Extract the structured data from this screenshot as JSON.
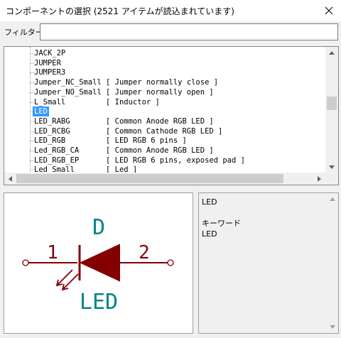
{
  "window": {
    "title": "コンポーネントの選択 (2521 アイテムが読込まれています)"
  },
  "filter": {
    "label": "フィルター:",
    "value": ""
  },
  "tree": {
    "rows": [
      {
        "name": "JACK_2P",
        "desc": ""
      },
      {
        "name": "JUMPER",
        "desc": ""
      },
      {
        "name": "JUMPER3",
        "desc": ""
      },
      {
        "name": "Jumper_NC_Small",
        "desc": "[ Jumper normally close ]"
      },
      {
        "name": "Jumper_NO_Small",
        "desc": "[ Jumper normally open ]"
      },
      {
        "name": "L_Small",
        "desc": "[ Inductor ]"
      },
      {
        "name": "LED",
        "desc": ""
      },
      {
        "name": "LED_RABG",
        "desc": "[ Common Anode RGB LED ]"
      },
      {
        "name": "LED_RCBG",
        "desc": "[ Common Cathode RGB LED ]"
      },
      {
        "name": "LED_RGB",
        "desc": "[ LED RGB 6 pins ]"
      },
      {
        "name": "Led_RGB_CA",
        "desc": "[ Common Anode RGB LED ]"
      },
      {
        "name": "LED_RGB_EP",
        "desc": "[ LED RGB 6 pins, exposed pad ]"
      },
      {
        "name": "Led_Small",
        "desc": "[ Led ]"
      }
    ],
    "selected_index": 6,
    "vscroll_position": 0.42,
    "hscroll_fraction": 0.9
  },
  "symbol": {
    "reference": "D",
    "value": "LED",
    "pin1": "1",
    "pin2": "2",
    "body_color": "#840000",
    "text_color": "#008484"
  },
  "info": {
    "name": "LED",
    "keywords_label": "キーワード",
    "keywords": "LED"
  },
  "icons": {
    "close": "close-icon",
    "scroll_up": "triangle-up-icon",
    "scroll_down": "triangle-down-icon",
    "scroll_left": "triangle-left-icon",
    "scroll_right": "triangle-right-icon"
  }
}
